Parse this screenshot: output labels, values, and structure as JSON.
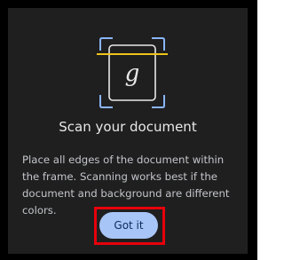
{
  "dialog": {
    "illustration_icon": "document-scan-icon",
    "glyph": "g",
    "title": "Scan your document",
    "body": "Place all edges of the document within the frame. Scanning works best if the document and background are different colors.",
    "primary_button": "Got it"
  },
  "colors": {
    "dialog_bg": "#1f1f1f",
    "accent_line": "#f0c419",
    "frame_stroke": "#8ab4f8",
    "button_bg": "#a8c5f7",
    "highlight": "#e6000a"
  }
}
